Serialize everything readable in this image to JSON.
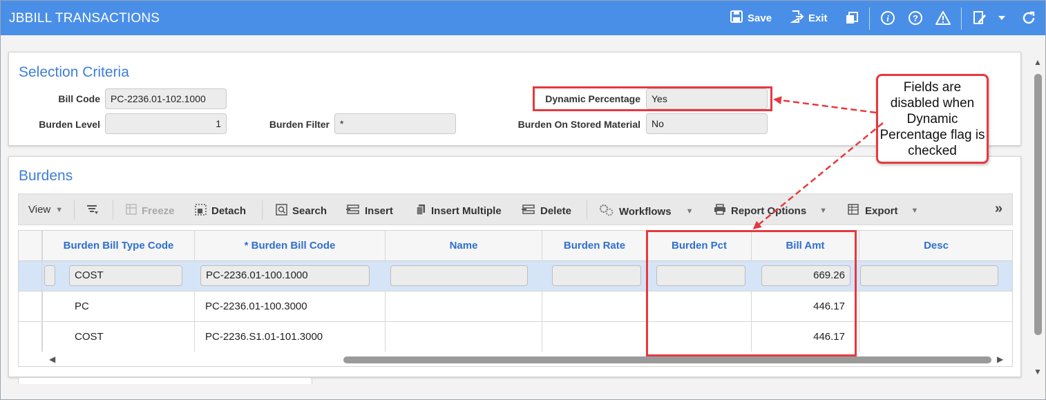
{
  "app": {
    "title": "JBBILL TRANSACTIONS",
    "save_label": "Save",
    "exit_label": "Exit",
    "header_color": "#4a8fe7"
  },
  "header_icons": [
    "save-icon",
    "exit-icon",
    "copy-icon",
    "info-icon",
    "help-icon",
    "warning-icon",
    "notes-icon",
    "chevron-down-icon",
    "refresh-icon"
  ],
  "selection": {
    "title": "Selection Criteria",
    "bill_code": {
      "label": "Bill Code",
      "value": "PC-2236.01-102.1000"
    },
    "burden_level": {
      "label": "Burden Level",
      "value": "1"
    },
    "burden_filter": {
      "label": "Burden Filter",
      "value": "*"
    },
    "dynamic_percentage": {
      "label": "Dynamic Percentage",
      "value": "Yes"
    },
    "burden_on_stored_material": {
      "label": "Burden On Stored Material",
      "value": "No"
    }
  },
  "burdens": {
    "title": "Burdens",
    "toolbar": {
      "view": "View",
      "freeze": "Freeze",
      "detach": "Detach",
      "search": "Search",
      "insert": "Insert",
      "insert_multiple": "Insert Multiple",
      "delete": "Delete",
      "workflows": "Workflows",
      "report_options": "Report Options",
      "export": "Export",
      "more": "»"
    },
    "columns": [
      "Burden Bill Type Code",
      "* Burden Bill Code",
      "Name",
      "Burden Rate",
      "Burden Pct",
      "Bill Amt",
      "Desc"
    ],
    "rows": [
      {
        "type_code": "COST",
        "bill_code": "PC-2236.01-100.1000",
        "name": "",
        "rate": "",
        "pct": "",
        "amt": "669.26",
        "desc": ""
      },
      {
        "type_code": "PC",
        "bill_code": "PC-2236.01-100.3000",
        "name": "",
        "rate": "",
        "pct": "",
        "amt": "446.17",
        "desc": ""
      },
      {
        "type_code": "COST",
        "bill_code": "PC-2236.S1.01-101.3000",
        "name": "",
        "rate": "",
        "pct": "",
        "amt": "446.17",
        "desc": ""
      }
    ]
  },
  "annotation": {
    "callout_text": "Fields are disabled when Dynamic Percentage flag is checked",
    "color": "#e5393e"
  }
}
